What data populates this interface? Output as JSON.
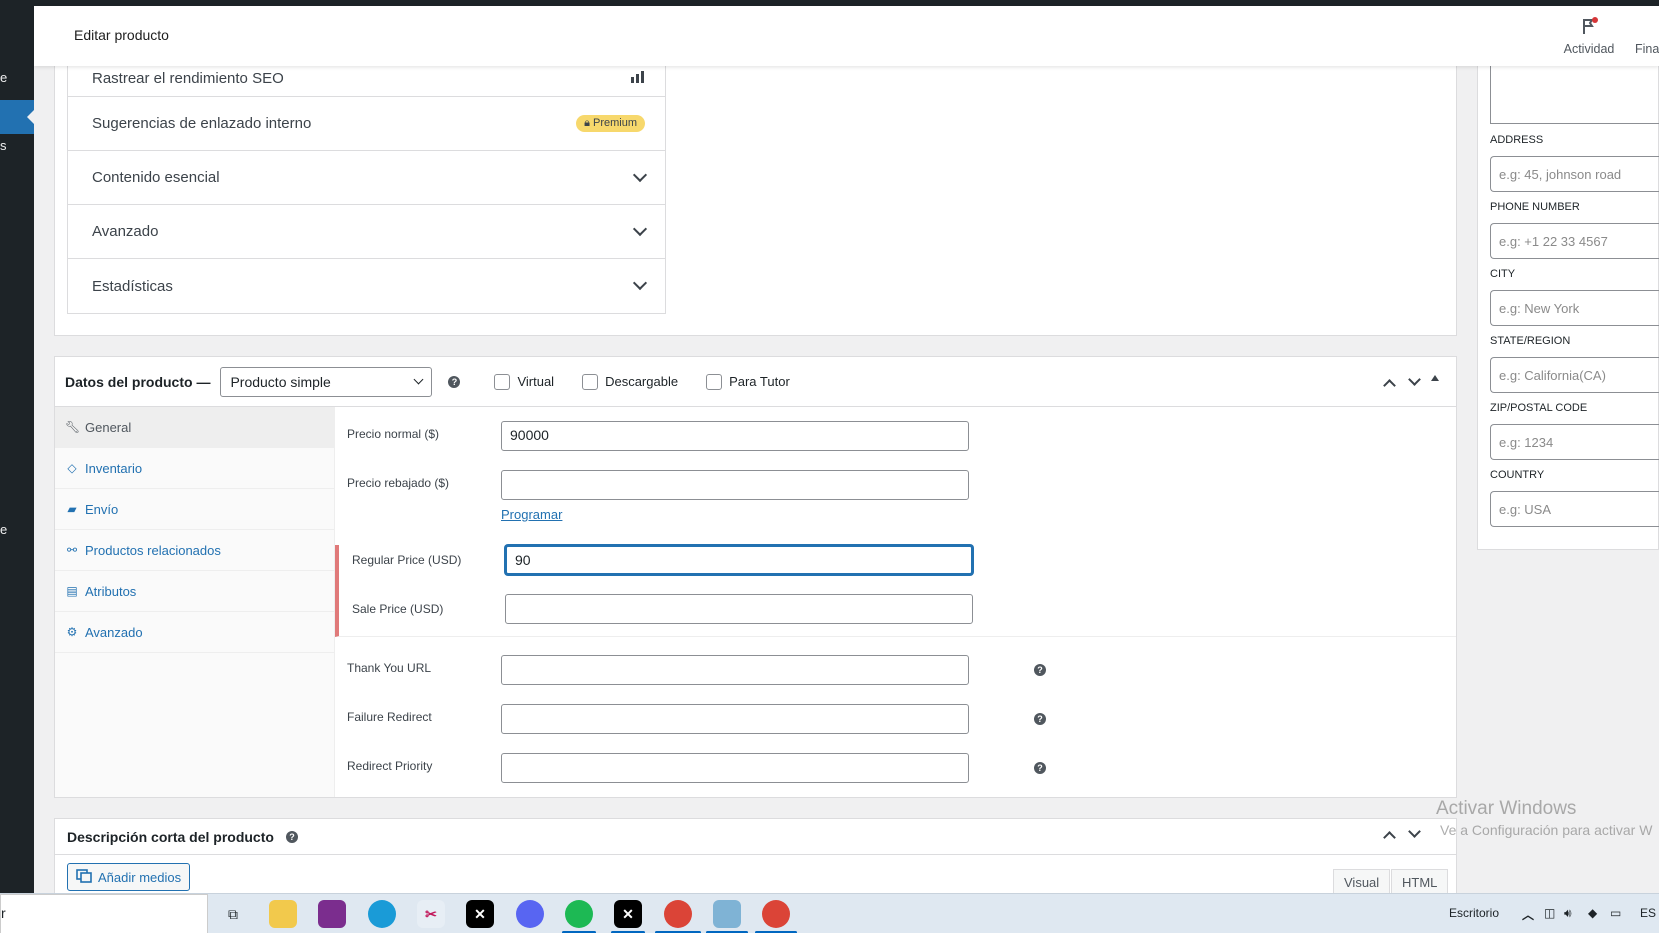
{
  "header": {
    "title": "Editar producto",
    "activity_label": "Actividad",
    "finance_label": "Fina"
  },
  "admin_menu": {
    "frag1": "e",
    "frag2": "s",
    "frag3": "e"
  },
  "seo_panel": {
    "items": [
      {
        "label": "Rastrear el rendimiento SEO"
      },
      {
        "label": "Sugerencias de enlazado interno",
        "badge": "Premium"
      },
      {
        "label": "Contenido esencial"
      },
      {
        "label": "Avanzado"
      },
      {
        "label": "Estadísticas"
      }
    ]
  },
  "product_data": {
    "label": "Datos del producto —",
    "type_selected": "Producto simple",
    "help": "?",
    "checkboxes": [
      {
        "label": "Virtual",
        "checked": false
      },
      {
        "label": "Descargable",
        "checked": false
      },
      {
        "label": "Para Tutor",
        "checked": false
      }
    ],
    "tabs": [
      {
        "label": "General",
        "icon": "wrench-icon"
      },
      {
        "label": "Inventario",
        "icon": "tag-icon"
      },
      {
        "label": "Envío",
        "icon": "truck-icon"
      },
      {
        "label": "Productos relacionados",
        "icon": "link-icon"
      },
      {
        "label": "Atributos",
        "icon": "list-icon"
      },
      {
        "label": "Avanzado",
        "icon": "gear-icon"
      }
    ],
    "fields": {
      "regular_price_label": "Precio normal ($)",
      "regular_price_value": "90000",
      "sale_price_label": "Precio rebajado ($)",
      "sale_price_value": "",
      "schedule_link": "Programar",
      "usd_regular_label": "Regular Price (USD)",
      "usd_regular_value": "90",
      "usd_sale_label": "Sale Price (USD)",
      "usd_sale_value": "",
      "thank_you_label": "Thank You URL",
      "failure_label": "Failure Redirect",
      "priority_label": "Redirect Priority"
    }
  },
  "short_description": {
    "title": "Descripción corta del producto",
    "add_media": "Añadir medios",
    "tab_visual": "Visual",
    "tab_html": "HTML"
  },
  "watermark": {
    "line1": "Activar Windows",
    "line2": "Ve a Configuración para activar W"
  },
  "address_panel": {
    "address_label": "ADDRESS",
    "address_placeholder": "e.g: 45, johnson road",
    "phone_label": "PHONE NUMBER",
    "phone_placeholder": "e.g: +1 22 33 4567",
    "city_label": "CITY",
    "city_placeholder": "e.g: New York",
    "state_label": "STATE/REGION",
    "state_placeholder": "e.g: California(CA)",
    "zip_label": "ZIP/POSTAL CODE",
    "zip_placeholder": "e.g: 1234",
    "country_label": "COUNTRY",
    "country_placeholder": "e.g: USA"
  },
  "taskbar": {
    "search_text": "r",
    "desktop_label": "Escritorio",
    "lang": "ES",
    "apps": [
      "task-view",
      "file-explorer",
      "winrar",
      "edge",
      "snipping-tool",
      "capcut",
      "discord",
      "spotify",
      "capcut-2",
      "chrome-profile-r",
      "notepad",
      "chrome"
    ]
  },
  "colors": {
    "accent": "#2271b1",
    "admin_bar": "#1d2327",
    "premium": "#f7d86c",
    "usd_marker": "#e07a7a"
  }
}
